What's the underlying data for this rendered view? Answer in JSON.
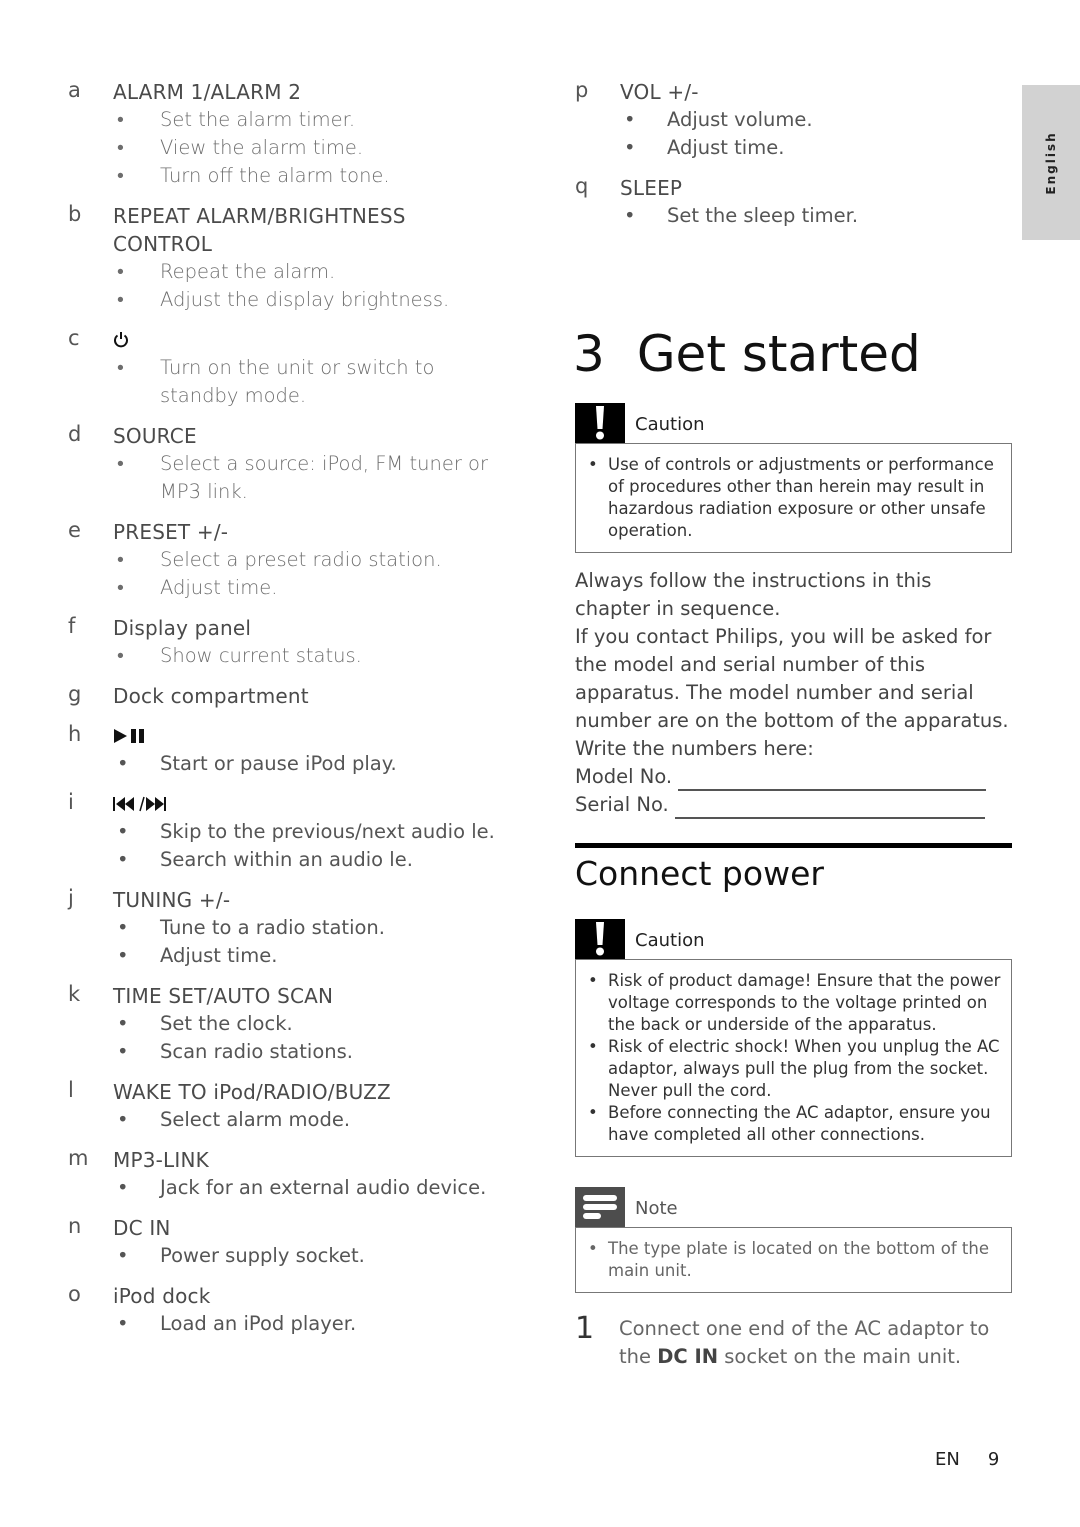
{
  "language_tab": "English",
  "left_items": [
    {
      "letter": "a",
      "title": "ALARM 1/ALARM 2",
      "bullets": [
        "Set the alarm timer.",
        "View the alarm time.",
        "Turn off the alarm tone."
      ]
    },
    {
      "letter": "b",
      "title": "REPEAT ALARM/BRIGHTNESS CONTROL",
      "bullets": [
        "Repeat the alarm.",
        "Adjust the display brightness."
      ]
    },
    {
      "letter": "c",
      "icon": "power-icon",
      "bullets": [
        "Turn on the unit or switch to standby mode."
      ]
    },
    {
      "letter": "d",
      "title": "SOURCE",
      "bullets": [
        "Select a source: iPod, FM tuner or MP3 link."
      ]
    },
    {
      "letter": "e",
      "title": "PRESET +/-",
      "bullets": [
        "Select a preset radio station.",
        "Adjust time."
      ]
    },
    {
      "letter": "f",
      "title": "Display panel",
      "bullets": [
        "Show current status."
      ]
    },
    {
      "letter": "g",
      "title": "Dock compartment",
      "bullets": []
    },
    {
      "letter": "h",
      "icon": "play-pause-icon",
      "bullets": [
        "Start or pause iPod play."
      ]
    },
    {
      "letter": "i",
      "icon": "prev-next-icon",
      "bullets": [
        "Skip to the previous/next audio  le.",
        "Search within an audio  le."
      ]
    },
    {
      "letter": "j",
      "title": "TUNING +/-",
      "bullets": [
        "Tune to a radio station.",
        "Adjust time."
      ]
    },
    {
      "letter": "k",
      "title": "TIME SET/AUTO SCAN",
      "bullets": [
        "Set the clock.",
        "Scan radio stations."
      ]
    },
    {
      "letter": "l",
      "title": "WAKE TO iPod/RADIO/BUZZ",
      "bullets": [
        "Select alarm mode."
      ]
    },
    {
      "letter": "m",
      "title": "MP3-LINK",
      "bullets": [
        "Jack for an external audio device."
      ]
    },
    {
      "letter": "n",
      "title": "DC IN",
      "bullets": [
        "Power supply socket."
      ]
    },
    {
      "letter": "o",
      "title": "iPod dock",
      "bullets": [
        "Load an iPod player."
      ]
    }
  ],
  "right_items": [
    {
      "letter": "p",
      "title": "VOL +/-",
      "bullets": [
        "Adjust volume.",
        "Adjust time."
      ]
    },
    {
      "letter": "q",
      "title": "SLEEP",
      "bullets": [
        "Set the sleep timer."
      ]
    }
  ],
  "chapter": {
    "number": "3",
    "title": "Get started"
  },
  "caution1": {
    "label": "Caution",
    "bullets": [
      "Use of controls or adjustments or performance of procedures other than herein may result in hazardous radiation exposure or other unsafe operation."
    ]
  },
  "intro_paragraphs": [
    "Always follow the instructions in this chapter in sequence.",
    "If you contact Philips, you will be asked for the model and serial number of this apparatus. The model number and serial number are on the bottom of the apparatus. Write the numbers here:"
  ],
  "fields": {
    "model_label": "Model No.",
    "serial_label": "Serial No."
  },
  "section2_title": "Connect power",
  "caution2": {
    "label": "Caution",
    "bullets": [
      "Risk of product damage! Ensure that the power voltage corresponds to the voltage printed on the back or underside of the apparatus.",
      "Risk of electric shock! When you unplug the AC adaptor, always pull the plug from the socket. Never pull the cord.",
      "Before connecting the AC adaptor, ensure you have completed all other connections."
    ]
  },
  "note": {
    "label": "Note",
    "bullets": [
      "The type plate is located on the bottom of the main unit."
    ]
  },
  "step1": {
    "number": "1",
    "pre": "Connect one end of the AC adaptor to the ",
    "bold": "DC IN",
    "post": " socket on the main unit."
  },
  "footer": {
    "lang": "EN",
    "page": "9"
  }
}
